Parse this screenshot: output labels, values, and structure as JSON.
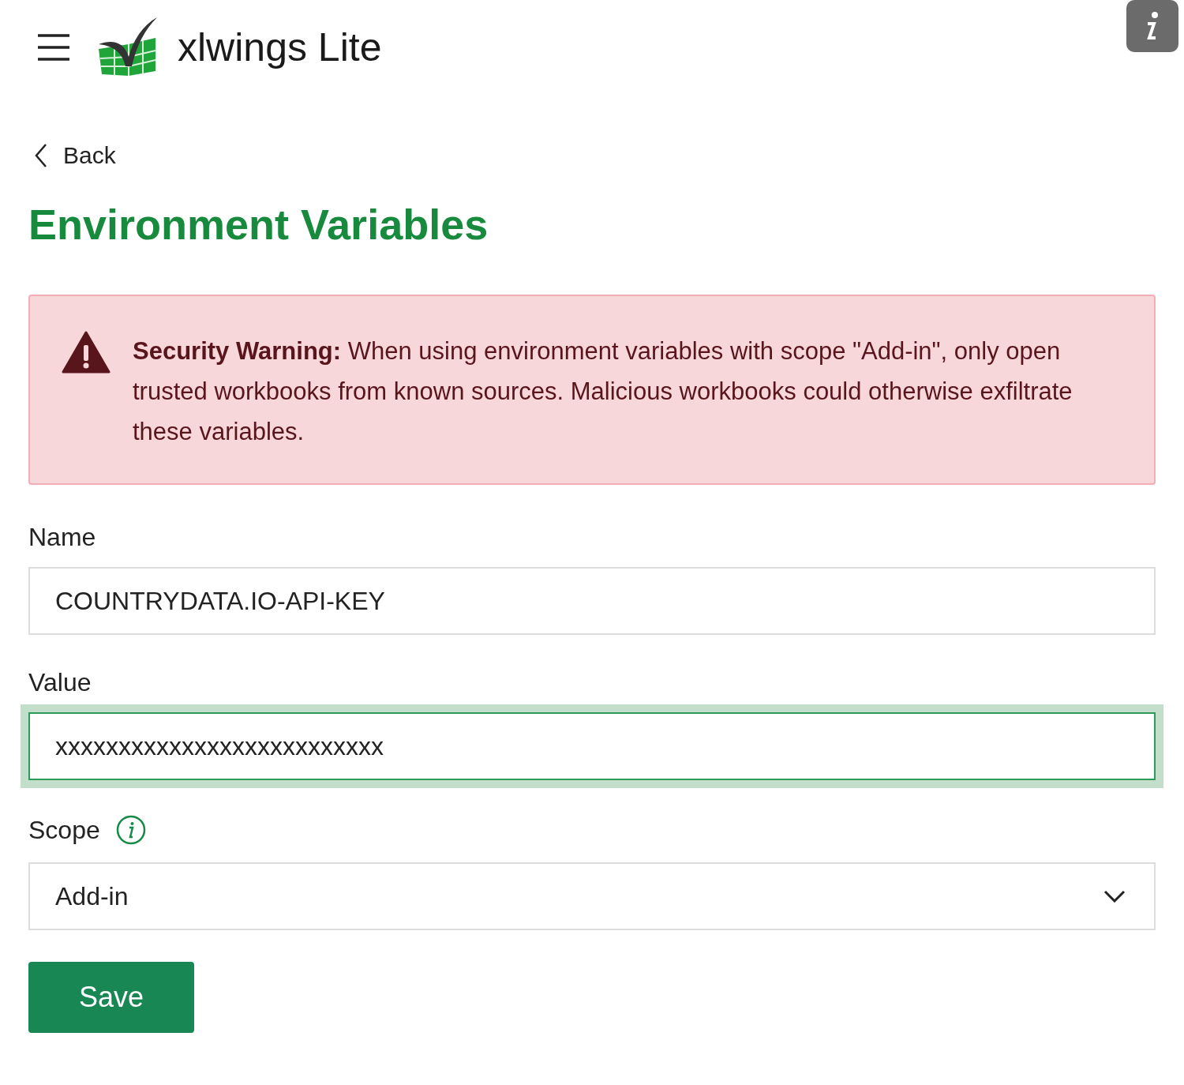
{
  "header": {
    "title": "xlwings Lite"
  },
  "back": {
    "label": "Back"
  },
  "page": {
    "title": "Environment Variables"
  },
  "warning": {
    "text": "**Security Warning:** When using environment variables with scope \"Add-in\", only open trusted workbooks from known sources. Malicious workbooks could otherwise exfiltrate these variables."
  },
  "fields": [
    {
      "kind": "text",
      "label": "Name",
      "value": "COUNTRYDATA.IO-API-KEY",
      "focused": false
    },
    {
      "kind": "text",
      "label": "Value",
      "value": "xxxxxxxxxxxxxxxxxxxxxxxxxx",
      "focused": true
    },
    {
      "kind": "select",
      "label": "Scope",
      "value": "Add-in",
      "focused": false,
      "has_info": true
    }
  ],
  "save_button": {
    "label": "Save"
  }
}
